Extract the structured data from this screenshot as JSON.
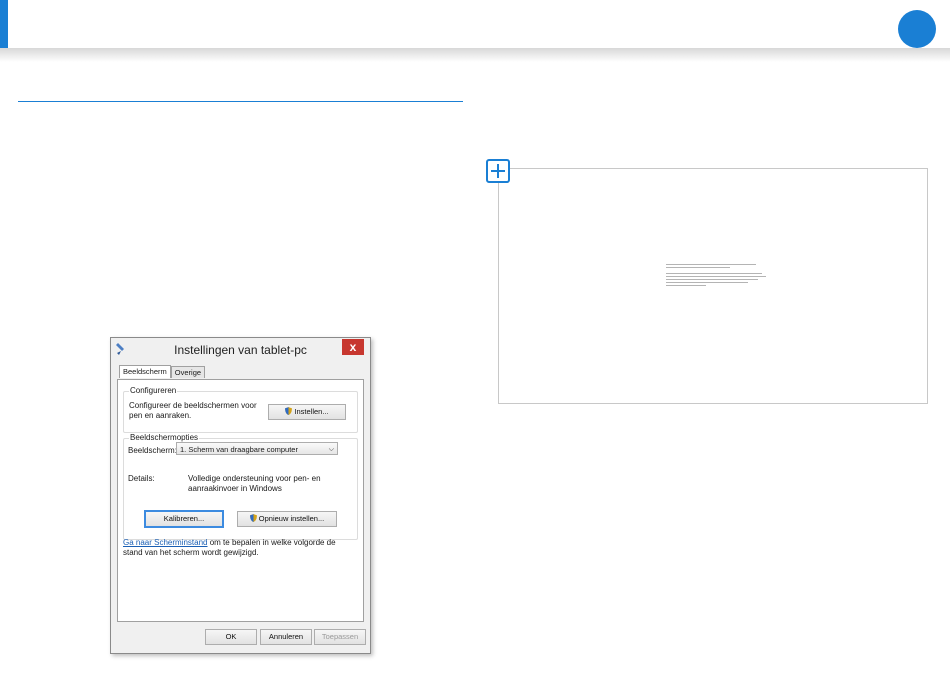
{
  "colors": {
    "accent": "#1a7fd4",
    "close_button": "#c7372f",
    "link": "#1a5fb4"
  },
  "dialog": {
    "title": "Instellingen van tablet-pc",
    "close_glyph": "x",
    "tabs": [
      {
        "label": "Beeldscherm"
      },
      {
        "label": "Overige"
      }
    ],
    "configure": {
      "group_title": "Configureren",
      "text": "Configureer de beeldschermen voor pen en aanraken.",
      "setup_button": "Instellen..."
    },
    "display_options": {
      "group_title": "Beeldschermopties",
      "display_label": "Beeldscherm:",
      "display_value": "1. Scherm van draagbare computer",
      "details_label": "Details:",
      "details_value": "Volledige ondersteuning voor pen- en aanraakinvoer in Windows",
      "calibrate_button": "Kalibreren...",
      "reset_button": "Opnieuw instellen..."
    },
    "orientation": {
      "link_text": "Ga naar Scherminstand",
      "rest_text": " om te bepalen in welke volgorde de stand van het scherm wordt gewijzigd."
    },
    "footer": {
      "ok": "OK",
      "cancel": "Annuleren",
      "apply": "Toepassen"
    }
  },
  "calibration": {
    "marker_icon": "crosshair-icon"
  }
}
